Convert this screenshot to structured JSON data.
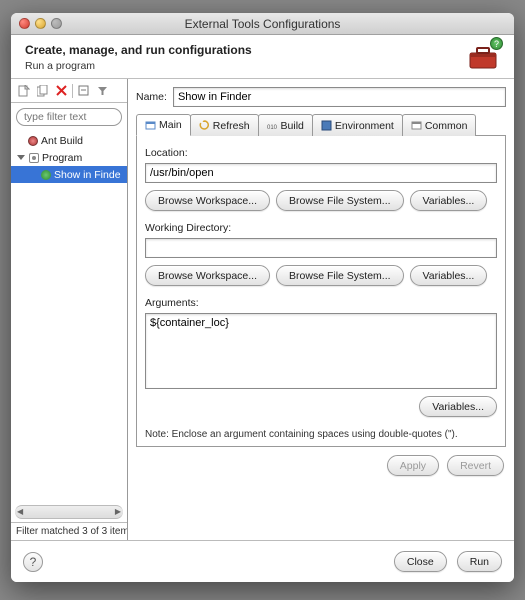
{
  "window": {
    "title": "External Tools Configurations"
  },
  "header": {
    "title": "Create, manage, and run configurations",
    "subtitle": "Run a program"
  },
  "sidebar": {
    "filter_placeholder": "type filter text",
    "items": [
      {
        "label": "Ant Build"
      },
      {
        "label": "Program"
      },
      {
        "label": "Show in Finde"
      }
    ],
    "status": "Filter matched 3 of 3 item"
  },
  "form": {
    "name_label": "Name:",
    "name_value": "Show in Finder",
    "tabs": [
      "Main",
      "Refresh",
      "Build",
      "Environment",
      "Common"
    ],
    "location": {
      "label": "Location:",
      "value": "/usr/bin/open",
      "buttons": [
        "Browse Workspace...",
        "Browse File System...",
        "Variables..."
      ]
    },
    "wd": {
      "label": "Working Directory:",
      "value": "",
      "buttons": [
        "Browse Workspace...",
        "Browse File System...",
        "Variables..."
      ]
    },
    "args": {
      "label": "Arguments:",
      "value": "${container_loc}",
      "buttons": [
        "Variables..."
      ]
    },
    "note": "Note: Enclose an argument containing spaces using double-quotes (\").",
    "apply": "Apply",
    "revert": "Revert"
  },
  "footer": {
    "close": "Close",
    "run": "Run"
  }
}
